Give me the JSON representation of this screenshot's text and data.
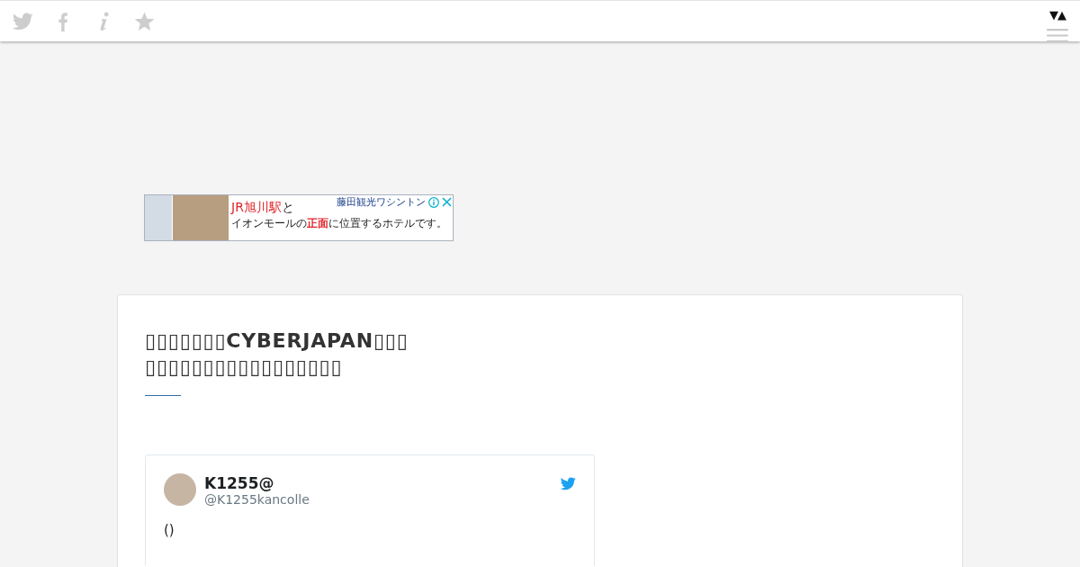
{
  "header": {
    "toggle": "▼▲"
  },
  "ad": {
    "headline": "**JR旭川駅**と",
    "sponsor": "藤田観光ワシントン",
    "text": "イオンモールの**正面**に位置するホテルです。"
  },
  "article": {
    "title": "▯▯▯▯▯▯▯CYBERJAPAN▯▯▯\n▯▯▯▯▯▯▯▯▯▯▯▯▯▯▯▯▯",
    "tweet": {
      "name": "K1255@",
      "handle": "@K1255kancolle",
      "text": "()"
    }
  }
}
